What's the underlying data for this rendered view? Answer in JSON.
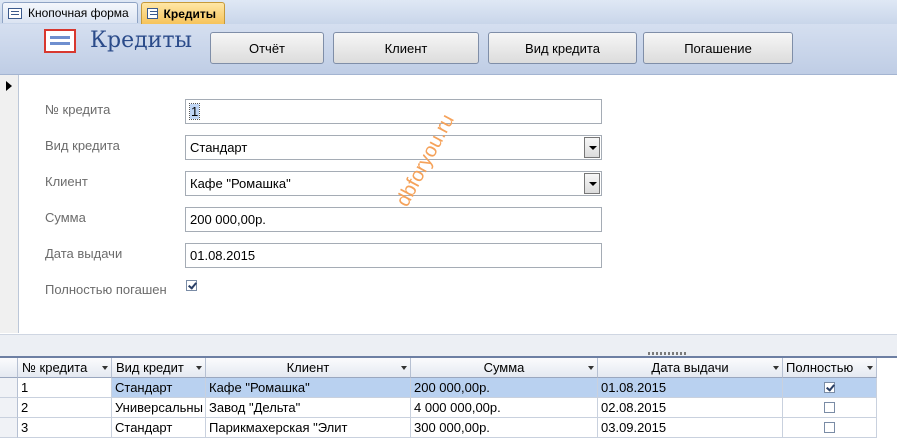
{
  "tabs": [
    {
      "label": "Кнопочная форма",
      "active": false
    },
    {
      "label": "Кредиты",
      "active": true
    }
  ],
  "header": {
    "title": "Кредиты",
    "buttons": [
      "Отчёт",
      "Клиент",
      "Вид кредита",
      "Погашение"
    ]
  },
  "form": {
    "credit_no": {
      "label": "№ кредита",
      "value": "1"
    },
    "credit_type": {
      "label": "Вид кредита",
      "value": "Стандарт"
    },
    "client": {
      "label": "Клиент",
      "value": "Кафе \"Ромашка\""
    },
    "amount": {
      "label": "Сумма",
      "value": "200 000,00р."
    },
    "issue_date": {
      "label": "Дата выдачи",
      "value": "01.08.2015"
    },
    "fully_paid": {
      "label": "Полностью погашен",
      "checked": true
    }
  },
  "watermark": "dbforyou.ru",
  "table": {
    "columns": [
      "№ кредита",
      "Вид кредит",
      "Клиент",
      "Сумма",
      "Дата выдачи",
      "Полностью"
    ],
    "rows": [
      {
        "no": "1",
        "type": "Стандарт",
        "client": "Кафе \"Ромашка\"",
        "amount": "200 000,00р.",
        "date": "01.08.2015",
        "paid": true
      },
      {
        "no": "2",
        "type": "Универсальны",
        "client": "Завод \"Дельта\"",
        "amount": "4 000 000,00р.",
        "date": "02.08.2015",
        "paid": false
      },
      {
        "no": "3",
        "type": "Стандарт",
        "client": "Парикмахерская \"Элит",
        "amount": "300 000,00р.",
        "date": "03.09.2015",
        "paid": false
      }
    ]
  },
  "colors": {
    "accent": "#2b4b8a",
    "tab_active": "#f6c35b",
    "row_selected": "#b9d1f0"
  }
}
